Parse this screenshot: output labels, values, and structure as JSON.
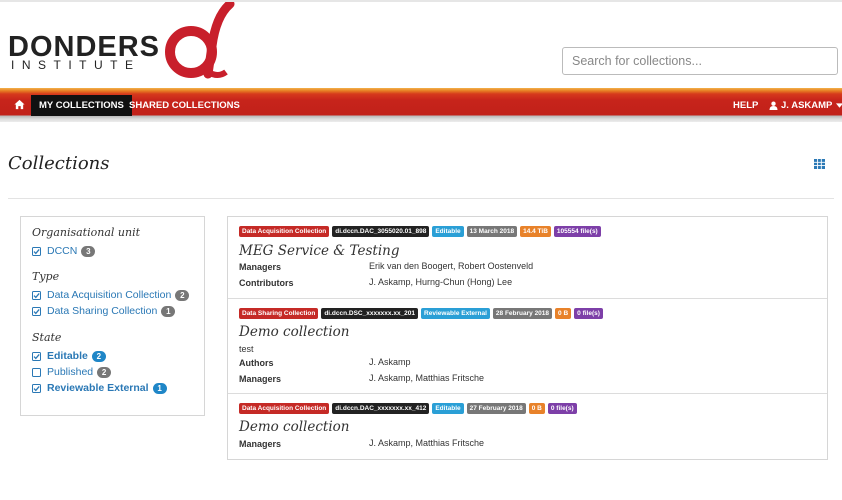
{
  "brand": {
    "name": "DONDERS",
    "subtitle": "INSTITUTE",
    "logo_color": "#c81f2b"
  },
  "search": {
    "placeholder": "Search for collections..."
  },
  "nav": {
    "home_icon": "home-icon",
    "items": [
      "MY COLLECTIONS",
      "SHARED COLLECTIONS"
    ],
    "active": "MY COLLECTIONS",
    "help": "HELP",
    "user": "J. ASKAMP",
    "user_icon": "user-icon",
    "caret_icon": "caret-down-icon",
    "bar_color": "#c1211a"
  },
  "page": {
    "title": "Collections",
    "view_icon": "table-icon"
  },
  "filters": {
    "org": {
      "heading": "Organisational unit",
      "items": [
        {
          "label": "DCCN",
          "count": "3",
          "checked": true
        }
      ]
    },
    "type": {
      "heading": "Type",
      "items": [
        {
          "label": "Data Acquisition Collection",
          "count": "2",
          "checked": true
        },
        {
          "label": "Data Sharing Collection",
          "count": "1",
          "checked": true
        }
      ]
    },
    "state": {
      "heading": "State",
      "items": [
        {
          "label": "Editable",
          "count": "2",
          "checked": true
        },
        {
          "label": "Published",
          "count": "2",
          "checked": false
        },
        {
          "label": "Reviewable External",
          "count": "1",
          "checked": true
        }
      ]
    }
  },
  "collections": [
    {
      "badges": [
        "Data Acquisition Collection",
        "di.dccn.DAC_3055020.01_898",
        "Editable",
        "13 March 2018",
        "14.4 TiB",
        "105554 file(s)"
      ],
      "title": "MEG Service & Testing",
      "description": "",
      "fields": [
        {
          "label": "Managers",
          "value": "Erik van den Boogert, Robert Oostenveld"
        },
        {
          "label": "Contributors",
          "value": "J. Askamp, Hurng-Chun (Hong) Lee"
        }
      ]
    },
    {
      "badges": [
        "Data Sharing Collection",
        "di.dccn.DSC_xxxxxxx.xx_201",
        "Reviewable External",
        "28 February 2018",
        "0 B",
        "0 file(s)"
      ],
      "title": "Demo collection",
      "description": "test",
      "fields": [
        {
          "label": "Authors",
          "value": "J. Askamp"
        },
        {
          "label": "Managers",
          "value": "J. Askamp, Matthias Fritsche"
        }
      ]
    },
    {
      "badges": [
        "Data Acquisition Collection",
        "di.dccn.DAC_xxxxxxx.xx_412",
        "Editable",
        "27 February 2018",
        "0 B",
        "0 file(s)"
      ],
      "title": "Demo collection",
      "description": "",
      "fields": [
        {
          "label": "Managers",
          "value": "J. Askamp, Matthias Fritsche"
        }
      ]
    }
  ],
  "badge_colors": {
    "collection_type": "#c52a26",
    "identifier": "#222222",
    "state": "#2a9fd6",
    "date": "#777777",
    "size": "#e8822a",
    "files": "#7d3fa8"
  },
  "accent_link": "#2a78b5"
}
